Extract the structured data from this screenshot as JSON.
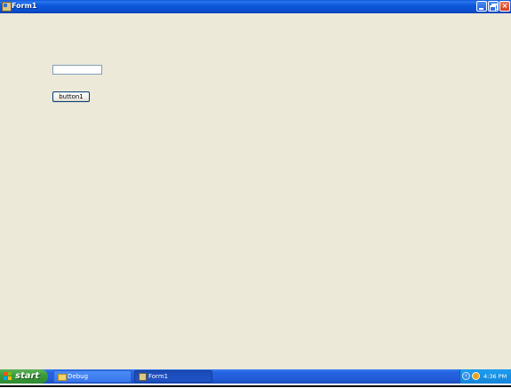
{
  "window": {
    "title": "Form1",
    "icon": "form-app-icon",
    "controls": {
      "minimize": "minimize-icon",
      "restore": "restore-icon",
      "close": "×"
    }
  },
  "form": {
    "textbox_value": "",
    "button_label": "button1"
  },
  "taskbar": {
    "start_label": "start",
    "tasks": [
      {
        "label": "Debug",
        "icon": "folder-icon"
      },
      {
        "label": "Form1",
        "icon": "form-app-icon"
      }
    ],
    "tray": {
      "chevron": "‹",
      "clock": "4:36 PM"
    }
  },
  "colors": {
    "desktop_bg": "#ece9d8",
    "titlebar": "#0a56d8",
    "taskbar": "#245edb",
    "start_button": "#3c9c3c"
  }
}
